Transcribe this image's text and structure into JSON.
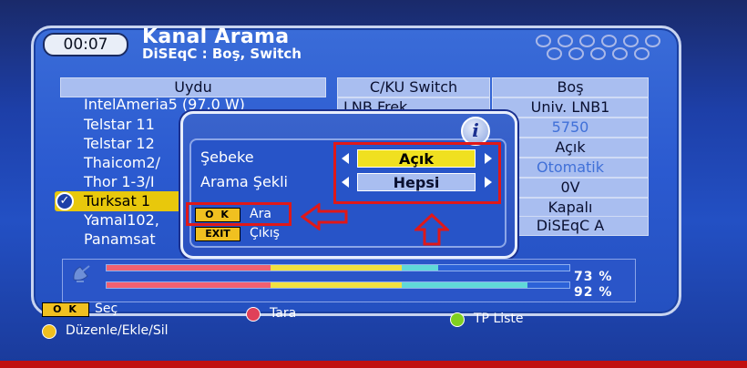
{
  "header": {
    "clock": "00:07",
    "title": "Kanal Arama",
    "subtitle": "DiSEqC : Boş, Switch"
  },
  "columns": {
    "satellite_header": "Uydu",
    "mid_header": "C/KU Switch",
    "right_header": "Boş"
  },
  "satellites": [
    "IntelAmeria5 (97.0 W)",
    "Telstar 11",
    "Telstar 12",
    "Thaicom2/",
    "Thor 1-3/I",
    "Turksat 1",
    "Yamal102,",
    "Panamsat"
  ],
  "mid_column": {
    "row1": "LNB Frek"
  },
  "right_column": [
    {
      "value": "Univ. LNB1",
      "dim": false
    },
    {
      "value": "5750",
      "dim": true
    },
    {
      "value": "Açık",
      "dim": false
    },
    {
      "value": "Otomatik",
      "dim": true
    },
    {
      "value": "0V",
      "dim": false
    },
    {
      "value": "Kapalı",
      "dim": false
    },
    {
      "value": "DiSEqC A",
      "dim": false
    }
  ],
  "dialog": {
    "info_icon": "i",
    "network_label": "Şebeke",
    "network_value": "Açık",
    "search_mode_label": "Arama Şekli",
    "search_mode_value": "Hepsi",
    "ok_key": "O K",
    "ok_action": "Ara",
    "exit_key": "EXIT",
    "exit_action": "Çıkış"
  },
  "signal": {
    "strength_percent": 73,
    "quality_percent": 92,
    "strength_label": "73 %",
    "quality_label": "92 %"
  },
  "footer": {
    "ok_key": "O K",
    "ok_label": "Seç",
    "red_label": "Tara",
    "green_label": "TP Liste",
    "yellow_label": "Düzenle/Ekle/Sil"
  },
  "colors": {
    "highlight_yellow": "#f0e020",
    "red": "#e01818",
    "green": "#80d020",
    "yellow": "#f0c020"
  }
}
